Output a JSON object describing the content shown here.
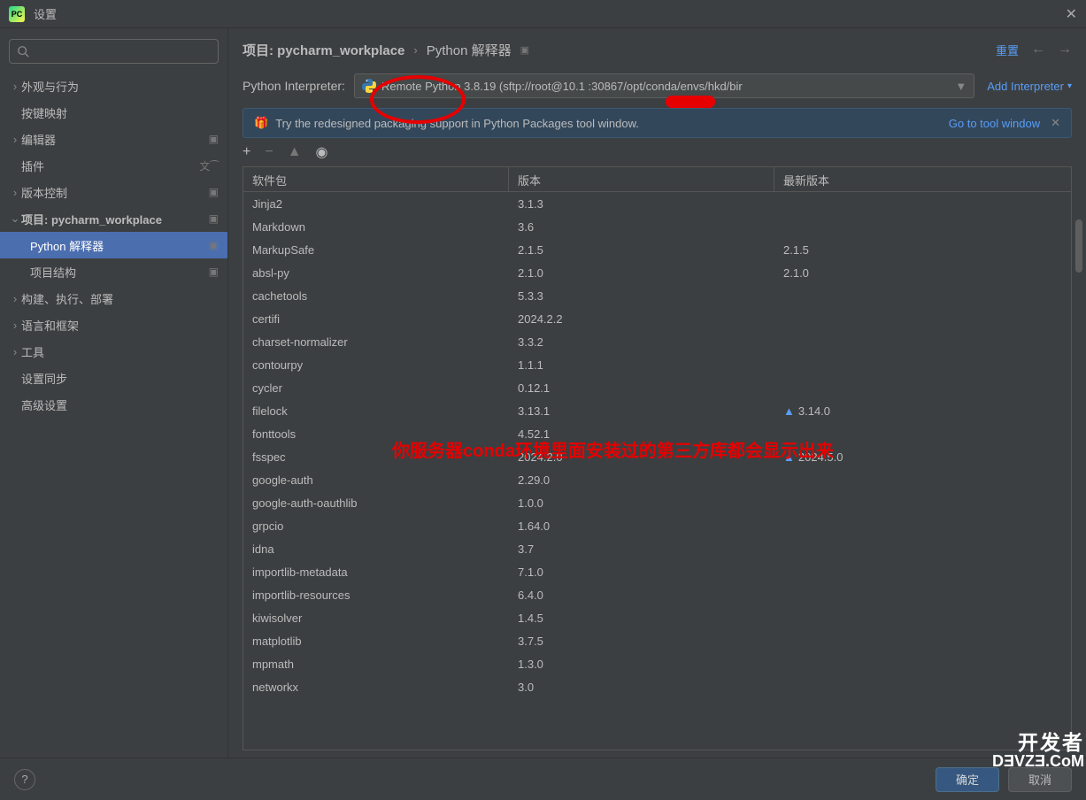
{
  "window": {
    "title": "设置"
  },
  "sidebar": {
    "items": [
      {
        "label": "外观与行为",
        "type": "chev",
        "expanded": false
      },
      {
        "label": "按键映射",
        "type": "plain"
      },
      {
        "label": "编辑器",
        "type": "chev",
        "expanded": false,
        "end": "box"
      },
      {
        "label": "插件",
        "type": "plain",
        "end": "lang"
      },
      {
        "label": "版本控制",
        "type": "chev",
        "expanded": false,
        "end": "box"
      },
      {
        "label": "项目: pycharm_workplace",
        "type": "chev",
        "expanded": true,
        "end": "box",
        "bold": true
      },
      {
        "label": "Python 解释器",
        "type": "child",
        "selected": true,
        "end": "box"
      },
      {
        "label": "项目结构",
        "type": "child",
        "end": "box"
      },
      {
        "label": "构建、执行、部署",
        "type": "chev",
        "expanded": false
      },
      {
        "label": "语言和框架",
        "type": "chev",
        "expanded": false
      },
      {
        "label": "工具",
        "type": "chev",
        "expanded": false
      },
      {
        "label": "设置同步",
        "type": "plain"
      },
      {
        "label": "高级设置",
        "type": "plain"
      }
    ]
  },
  "breadcrumb": {
    "a": "项目: pycharm_workplace",
    "b": "Python 解释器",
    "reset": "重置"
  },
  "interpreter": {
    "label": "Python Interpreter:",
    "value": "Remote Python 3.8.19 (sftp://root@10.1          :30867/opt/conda/envs/hkd/bir",
    "add": "Add Interpreter"
  },
  "banner": {
    "msg": "Try the redesigned packaging support in Python Packages tool window.",
    "link": "Go to tool window"
  },
  "table": {
    "headers": {
      "c1": "软件包",
      "c2": "版本",
      "c3": "最新版本"
    },
    "rows": [
      {
        "n": "Jinja2",
        "v": "3.1.3",
        "l": ""
      },
      {
        "n": "Markdown",
        "v": "3.6",
        "l": ""
      },
      {
        "n": "MarkupSafe",
        "v": "2.1.5",
        "l": "2.1.5"
      },
      {
        "n": "absl-py",
        "v": "2.1.0",
        "l": "2.1.0"
      },
      {
        "n": "cachetools",
        "v": "5.3.3",
        "l": ""
      },
      {
        "n": "certifi",
        "v": "2024.2.2",
        "l": ""
      },
      {
        "n": "charset-normalizer",
        "v": "3.3.2",
        "l": ""
      },
      {
        "n": "contourpy",
        "v": "1.1.1",
        "l": ""
      },
      {
        "n": "cycler",
        "v": "0.12.1",
        "l": ""
      },
      {
        "n": "filelock",
        "v": "3.13.1",
        "l": "3.14.0",
        "u": true
      },
      {
        "n": "fonttools",
        "v": "4.52.1",
        "l": ""
      },
      {
        "n": "fsspec",
        "v": "2024.2.0",
        "l": "2024.5.0",
        "u": true
      },
      {
        "n": "google-auth",
        "v": "2.29.0",
        "l": ""
      },
      {
        "n": "google-auth-oauthlib",
        "v": "1.0.0",
        "l": ""
      },
      {
        "n": "grpcio",
        "v": "1.64.0",
        "l": ""
      },
      {
        "n": "idna",
        "v": "3.7",
        "l": ""
      },
      {
        "n": "importlib-metadata",
        "v": "7.1.0",
        "l": ""
      },
      {
        "n": "importlib-resources",
        "v": "6.4.0",
        "l": ""
      },
      {
        "n": "kiwisolver",
        "v": "1.4.5",
        "l": ""
      },
      {
        "n": "matplotlib",
        "v": "3.7.5",
        "l": ""
      },
      {
        "n": "mpmath",
        "v": "1.3.0",
        "l": ""
      },
      {
        "n": "networkx",
        "v": "3.0",
        "l": ""
      }
    ]
  },
  "footer": {
    "ok": "确定",
    "cancel": "取消"
  },
  "annotation": {
    "text": "你服务器conda环境里面安装过的第三方库都会显示出来"
  },
  "watermark": {
    "l1": "开发者",
    "l2": "DƎVZƎ.CoM"
  }
}
